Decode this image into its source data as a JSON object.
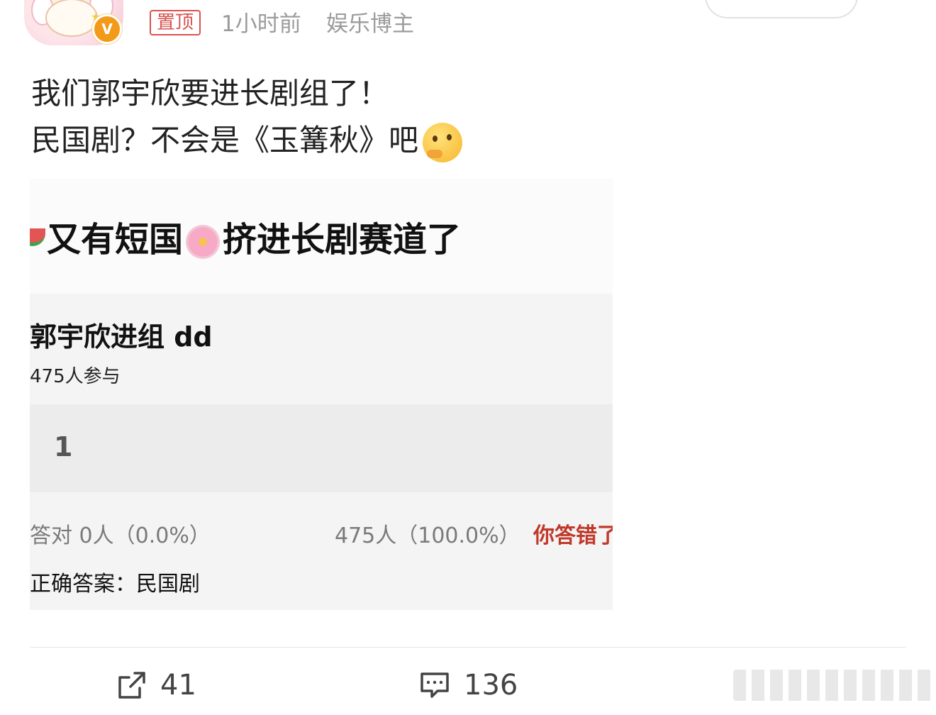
{
  "header": {
    "pin_label": "置顶",
    "time": "1小时前",
    "source": "娱乐博主",
    "verified_badge": "V"
  },
  "post": {
    "line1": "我们郭宇欣要进长剧组了！",
    "line2": "民国剧？不会是《玉篝秋》吧"
  },
  "embed": {
    "headline_part1": "又有短国",
    "headline_part2": "挤进长剧赛道了",
    "quiz_title": "郭宇欣进组 dd",
    "participants": "475人参与",
    "option_label": "1",
    "correct_stat": "答对  0人（0.0%）",
    "wrong_stat": "475人（100.0%）",
    "wrong_label": "你答错了",
    "answer": "正确答案：民国剧"
  },
  "actions": {
    "forward_count": "41",
    "comment_count": "136"
  },
  "icons": [
    "forward-icon",
    "comment-icon",
    "thinking-face-emoji",
    "cherry-blossom-emoji",
    "watermelon-emoji",
    "verified-icon"
  ],
  "colors": {
    "accent_red": "#d9534f",
    "verified_orange": "#f39a1b",
    "meta_gray": "#9b9b9b"
  }
}
